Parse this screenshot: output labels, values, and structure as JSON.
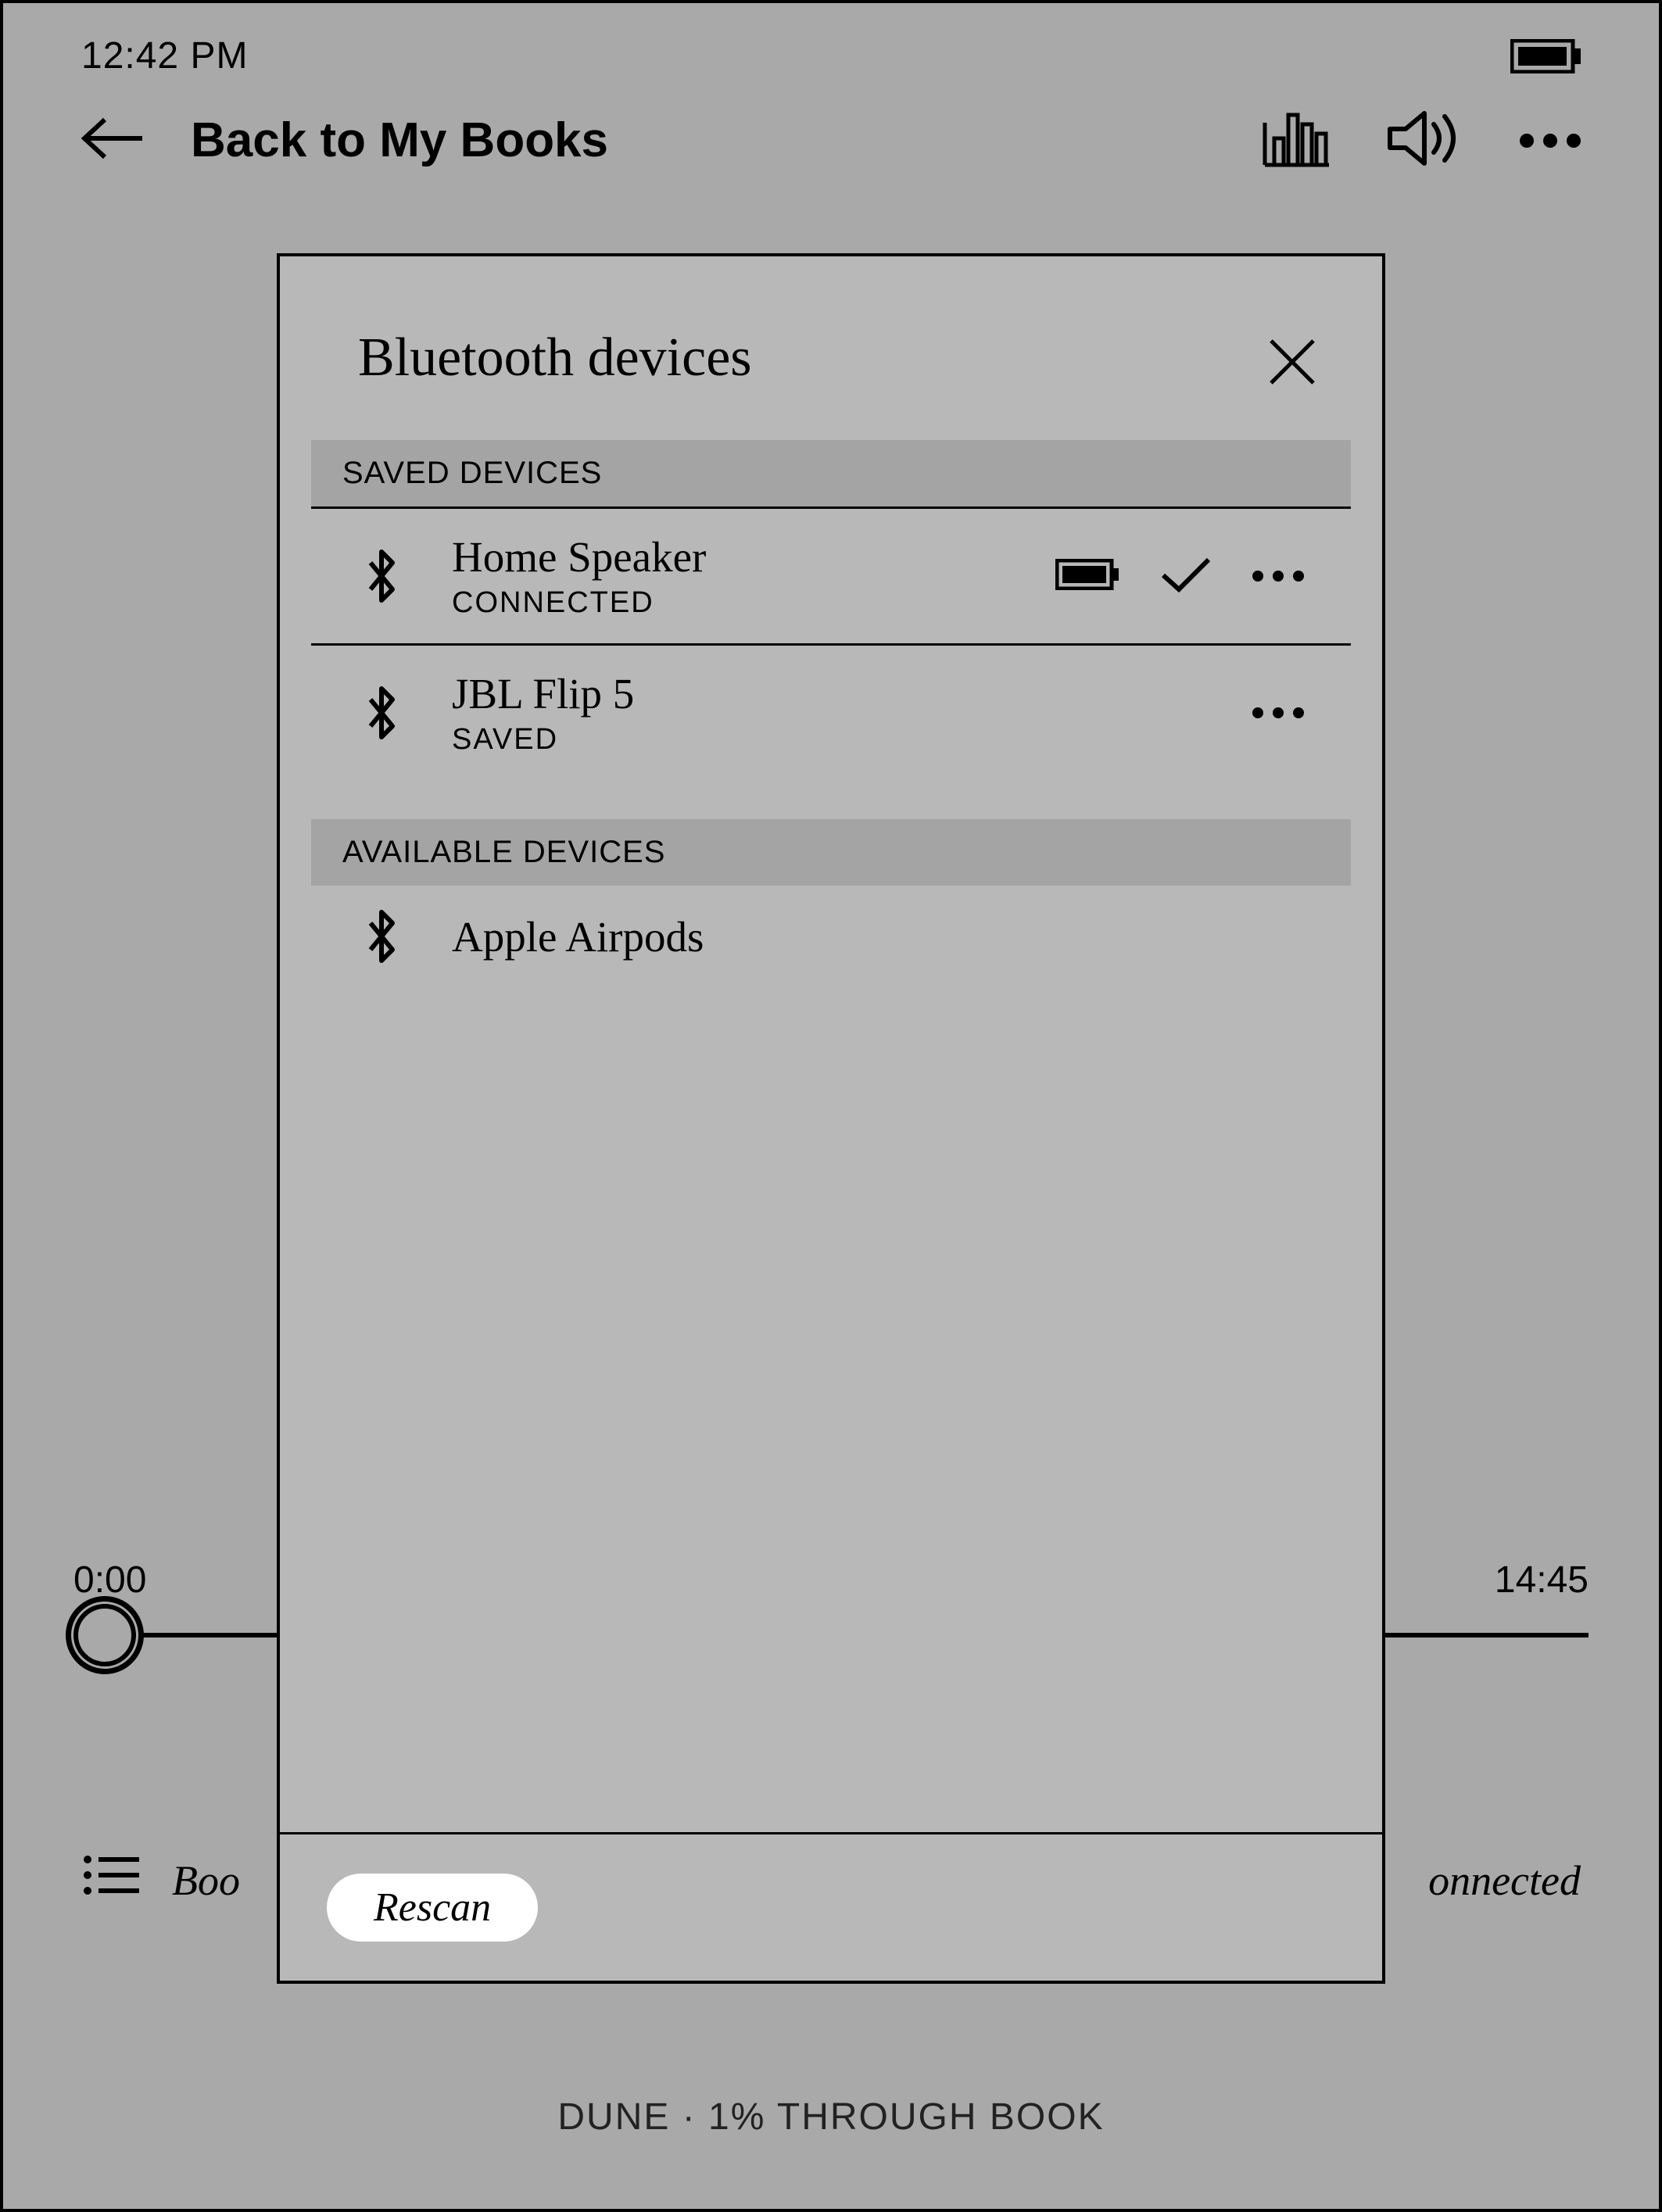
{
  "status": {
    "time": "12:42 PM"
  },
  "topnav": {
    "title": "Back to My Books"
  },
  "player": {
    "elapsed": "0:00",
    "remaining": "14:45"
  },
  "bottom": {
    "left_partial": "Boo",
    "right_partial": "onnected"
  },
  "summary": {
    "text": "DUNE · 1% THROUGH BOOK"
  },
  "modal": {
    "title": "Bluetooth devices",
    "saved_header": "SAVED DEVICES",
    "available_header": "AVAILABLE DEVICES",
    "saved": [
      {
        "name": "Home Speaker",
        "status": "CONNECTED",
        "connected": true
      },
      {
        "name": "JBL Flip 5",
        "status": "SAVED",
        "connected": false
      }
    ],
    "available": [
      {
        "name": "Apple Airpods"
      }
    ],
    "rescan": "Rescan"
  }
}
